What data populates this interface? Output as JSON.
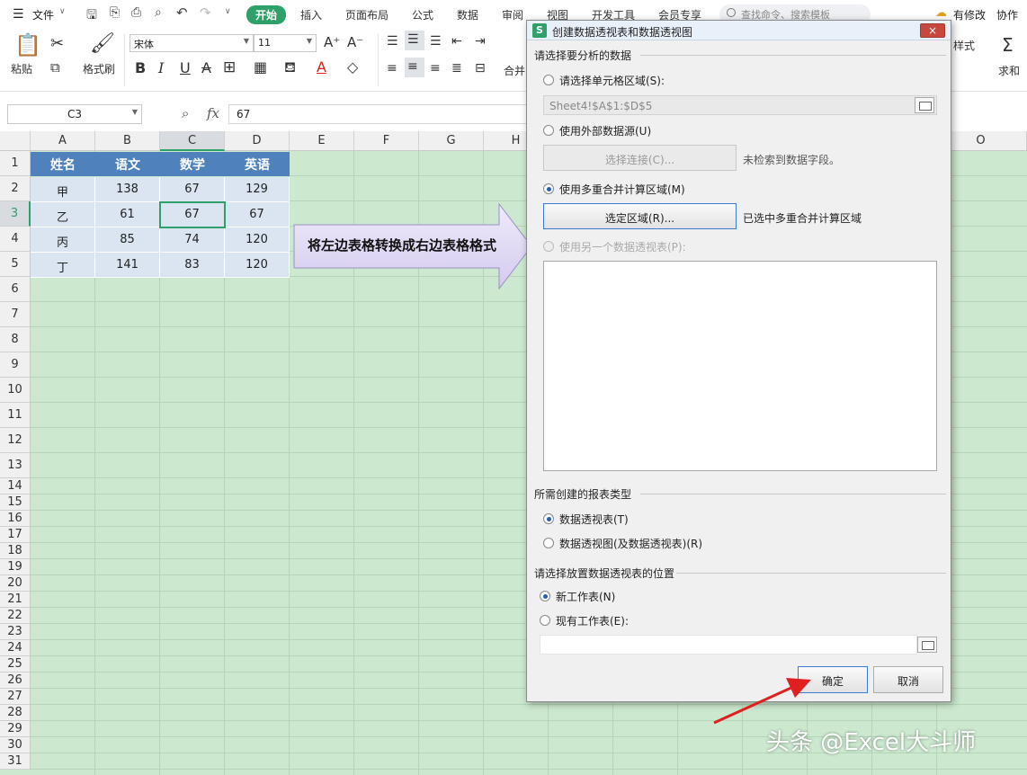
{
  "toolbar": {
    "menu_label": "文件",
    "tabs": [
      "开始",
      "插入",
      "页面布局",
      "公式",
      "数据",
      "审阅",
      "视图",
      "开发工具",
      "会员专享"
    ],
    "search_placeholder": "查找命令、搜索模板",
    "right_items": [
      "有修改",
      "协作"
    ],
    "paste_label": "粘贴",
    "format_painter_label": "格式刷",
    "font_name": "宋体",
    "font_size": "11",
    "merge_label": "合并",
    "style_label": "样式",
    "sum_label": "求和"
  },
  "formula_bar": {
    "cell_ref": "C3",
    "fx": "fx",
    "value": "67"
  },
  "grid": {
    "columns": [
      "A",
      "B",
      "C",
      "D",
      "E",
      "F",
      "G",
      "H",
      "O"
    ],
    "rows": [
      "1",
      "2",
      "3",
      "4",
      "5",
      "6",
      "7",
      "8",
      "9",
      "10",
      "11",
      "12",
      "13",
      "14",
      "15",
      "16",
      "17",
      "18",
      "19",
      "20",
      "21",
      "22",
      "23",
      "24",
      "25",
      "26",
      "27",
      "28",
      "29",
      "30",
      "31"
    ],
    "selected_column": "C",
    "selected_row": "3",
    "table": {
      "headers": [
        "姓名",
        "语文",
        "数学",
        "英语"
      ],
      "rows": [
        [
          "甲",
          "138",
          "67",
          "129"
        ],
        [
          "乙",
          "61",
          "67",
          "67"
        ],
        [
          "丙",
          "85",
          "74",
          "120"
        ],
        [
          "丁",
          "141",
          "83",
          "120"
        ]
      ]
    }
  },
  "callout": {
    "text": "将左边表格转换成右边表格格式"
  },
  "dialog": {
    "title": "创建数据透视表和数据透视图",
    "close": "×",
    "section_source": "请选择要分析的数据",
    "opt_range": "请选择单元格区域(S):",
    "range_value": "Sheet4!$A$1:$D$5",
    "opt_external": "使用外部数据源(U)",
    "choose_connection": "选择连接(C)...",
    "no_fields": "未检索到数据字段。",
    "opt_multi": "使用多重合并计算区域(M)",
    "select_region": "选定区域(R)...",
    "selected_multi": "已选中多重合并计算区域",
    "opt_other_pivot": "使用另一个数据透视表(P):",
    "section_type": "所需创建的报表类型",
    "type_pivot": "数据透视表(T)",
    "type_chart": "数据透视图(及数据透视表)(R)",
    "section_location": "请选择放置数据透视表的位置",
    "loc_new": "新工作表(N)",
    "loc_existing": "现有工作表(E):",
    "ok": "确定",
    "cancel": "取消"
  },
  "watermark": "头条 @Excel大斗师",
  "colors": {
    "accent": "#2fa06a",
    "grid_bg": "#cce8cf",
    "table_header": "#4f81bd",
    "table_body": "#dbe5f1",
    "callout_fill": "#e2dcf5",
    "arrow": "#e02020"
  }
}
